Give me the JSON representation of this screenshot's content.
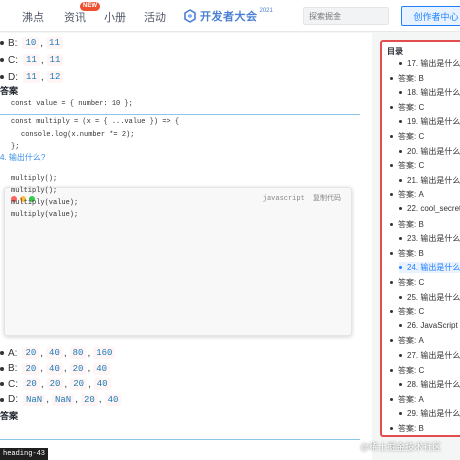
{
  "nav": {
    "items": [
      "沸点",
      "资讯",
      "小册",
      "活动"
    ],
    "new_badge": "NEW",
    "banner_text": "开发者大会",
    "banner_year": "2021",
    "search_placeholder": "探索掘金",
    "creator_label": "创作者中心"
  },
  "article": {
    "top_options": [
      {
        "label": "B:",
        "values": [
          "10",
          "11"
        ]
      },
      {
        "label": "C:",
        "values": [
          "11",
          "11"
        ]
      },
      {
        "label": "D:",
        "values": [
          "11",
          "12"
        ]
      }
    ],
    "answer_label": "答案",
    "question_text": "4. 输出什么?",
    "code": {
      "lang": "javascript",
      "copy_label": "复制代码",
      "lines": [
        "const value = { number: 10 };",
        "",
        "const multiply = (x = { ...value }) => {",
        "console.log(x.number *= 2);",
        "};",
        "",
        "multiply();",
        "multiply();",
        "multiply(value);",
        "multiply(value);"
      ]
    },
    "bottom_options": [
      {
        "label": "A:",
        "values": [
          "20",
          "40",
          "80",
          "160"
        ]
      },
      {
        "label": "B:",
        "values": [
          "20",
          "40",
          "20",
          "40"
        ]
      },
      {
        "label": "C:",
        "values": [
          "20",
          "20",
          "20",
          "40"
        ]
      },
      {
        "label": "D:",
        "values": [
          "NaN",
          "NaN",
          "20",
          "40"
        ]
      }
    ],
    "bottom_answer_label": "答案",
    "status_tip": "heading-43"
  },
  "toc": {
    "title": "目录",
    "items": [
      {
        "text": "17. 输出是什么?",
        "level": 2,
        "active": false
      },
      {
        "text": "答案: B",
        "level": 1,
        "active": false
      },
      {
        "text": "18. 输出是什么?",
        "level": 2,
        "active": false
      },
      {
        "text": "答案: C",
        "level": 1,
        "active": false
      },
      {
        "text": "19. 输出是什么?",
        "level": 2,
        "active": false
      },
      {
        "text": "答案: C",
        "level": 1,
        "active": false
      },
      {
        "text": "20. 输出是什么?",
        "level": 2,
        "active": false
      },
      {
        "text": "答案: C",
        "level": 1,
        "active": false
      },
      {
        "text": "21. 输出是什么?",
        "level": 2,
        "active": false
      },
      {
        "text": "答案: A",
        "level": 1,
        "active": false
      },
      {
        "text": "22. cool_secret",
        "level": 2,
        "active": false
      },
      {
        "text": "答案: B",
        "level": 1,
        "active": false
      },
      {
        "text": "23. 输出是什么?",
        "level": 2,
        "active": false
      },
      {
        "text": "答案: B",
        "level": 1,
        "active": false
      },
      {
        "text": "24. 输出是什么?",
        "level": 2,
        "active": true
      },
      {
        "text": "答案: C",
        "level": 1,
        "active": false
      },
      {
        "text": "25. 输出是什么?",
        "level": 2,
        "active": false
      },
      {
        "text": "答案: C",
        "level": 1,
        "active": false
      },
      {
        "text": "26. JavaScript",
        "level": 2,
        "active": false
      },
      {
        "text": "答案: A",
        "level": 1,
        "active": false
      },
      {
        "text": "27. 输出是什么?",
        "level": 2,
        "active": false
      },
      {
        "text": "答案: C",
        "level": 1,
        "active": false
      },
      {
        "text": "28. 输出是什么?",
        "level": 2,
        "active": false
      },
      {
        "text": "答案: A",
        "level": 1,
        "active": false
      },
      {
        "text": "29. 输出是什么?",
        "level": 2,
        "active": false
      },
      {
        "text": "答案: B",
        "level": 1,
        "active": false
      },
      {
        "text": "30. 输出是什么?",
        "level": 2,
        "active": false
      }
    ]
  },
  "watermark": "@稀土掘金技术社区",
  "colors": {
    "accent": "#1e80ff",
    "toc_border": "#e34d4d",
    "code_chip_text": "#1a7ab7",
    "mac_red": "#fc625d",
    "mac_yellow": "#fdbc40",
    "mac_green": "#35cd4b"
  }
}
